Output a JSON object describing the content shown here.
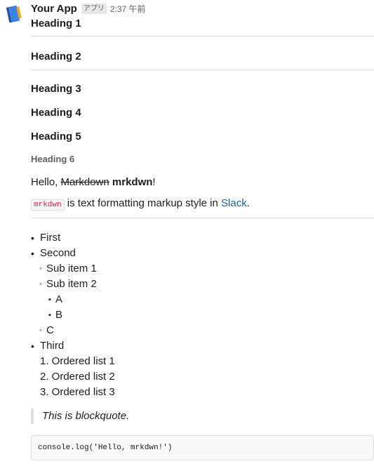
{
  "message": {
    "sender": "Your App",
    "badge": "アプリ",
    "timestamp": "2:37 午前"
  },
  "headings": {
    "h1": "Heading 1",
    "h2": "Heading 2",
    "h3": "Heading 3",
    "h4": "Heading 4",
    "h5": "Heading 5",
    "h6": "Heading 6"
  },
  "paragraph1": {
    "prefix": "Hello, ",
    "strike": "Markdown",
    "space": " ",
    "bold": "mrkdwn",
    "suffix": "!"
  },
  "paragraph2": {
    "code": "mrkdwn",
    "text": " is text formatting markup style in ",
    "link": "Slack",
    "suffix": "."
  },
  "list": {
    "bullet1": "•",
    "bullet2": "◦",
    "bullet3": "▪",
    "items": [
      "First",
      "Second",
      "Sub item 1",
      "Sub item 2",
      "A",
      "B",
      "C",
      "Third"
    ],
    "ordered": [
      "1. Ordered list 1",
      "2. Ordered list 2",
      "3. Ordered list 3"
    ]
  },
  "blockquote": "This is blockquote.",
  "codeblock": "console.log('Hello, mrkdwn!')"
}
